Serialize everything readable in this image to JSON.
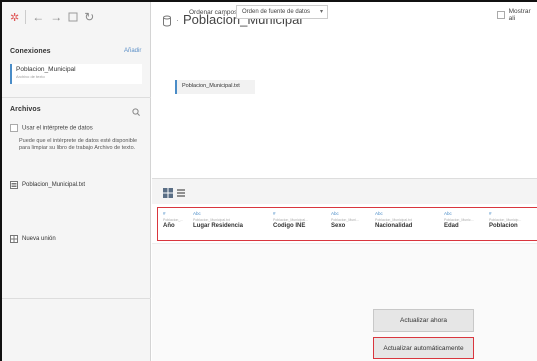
{
  "header": {
    "title": "Poblacion_Municipal"
  },
  "connections": {
    "title": "Conexiones",
    "add_link": "Añadir",
    "items": [
      {
        "name": "Poblacion_Municipal",
        "subtitle": "Archivo de texto"
      }
    ]
  },
  "files": {
    "title": "Archivos",
    "search_icon": "search-icon",
    "interpreter_label": "Usar el intérprete de datos",
    "interpreter_desc": "Puede que el intérprete de datos esté disponible para limpiar su libro de trabajo Archivo de texto.",
    "items": [
      {
        "name": "Poblacion_Municipal.txt"
      }
    ],
    "new_union": "Nueva unión"
  },
  "canvas": {
    "table_name": "Poblacion_Municipal.txt"
  },
  "grid_toolbar": {
    "sort_label": "Ordenar campos",
    "sort_value": "Orden de fuente de datos",
    "show_label": "Mostrar ali"
  },
  "fields": [
    {
      "type": "#",
      "source": "Poblacion_...",
      "name": "Año"
    },
    {
      "type": "Abc",
      "source": "Poblacion_Municipal.txt",
      "name": "Lugar Residencia"
    },
    {
      "type": "#",
      "source": "Poblacion_Municipal...",
      "name": "Codigo INE"
    },
    {
      "type": "Abc",
      "source": "Poblacion_Muni...",
      "name": "Sexo"
    },
    {
      "type": "Abc",
      "source": "Poblacion_Municipal.txt",
      "name": "Nacionalidad"
    },
    {
      "type": "Abc",
      "source": "Poblacion_Munic...",
      "name": "Edad"
    },
    {
      "type": "#",
      "source": "Poblacion_Municip...",
      "name": "Poblacion"
    }
  ],
  "actions": {
    "update_now": "Actualizar ahora",
    "update_auto": "Actualizar automáticamente"
  },
  "colors": {
    "accent": "#4a8cc7",
    "highlight": "#d9363e",
    "link": "#5b8fc7"
  }
}
